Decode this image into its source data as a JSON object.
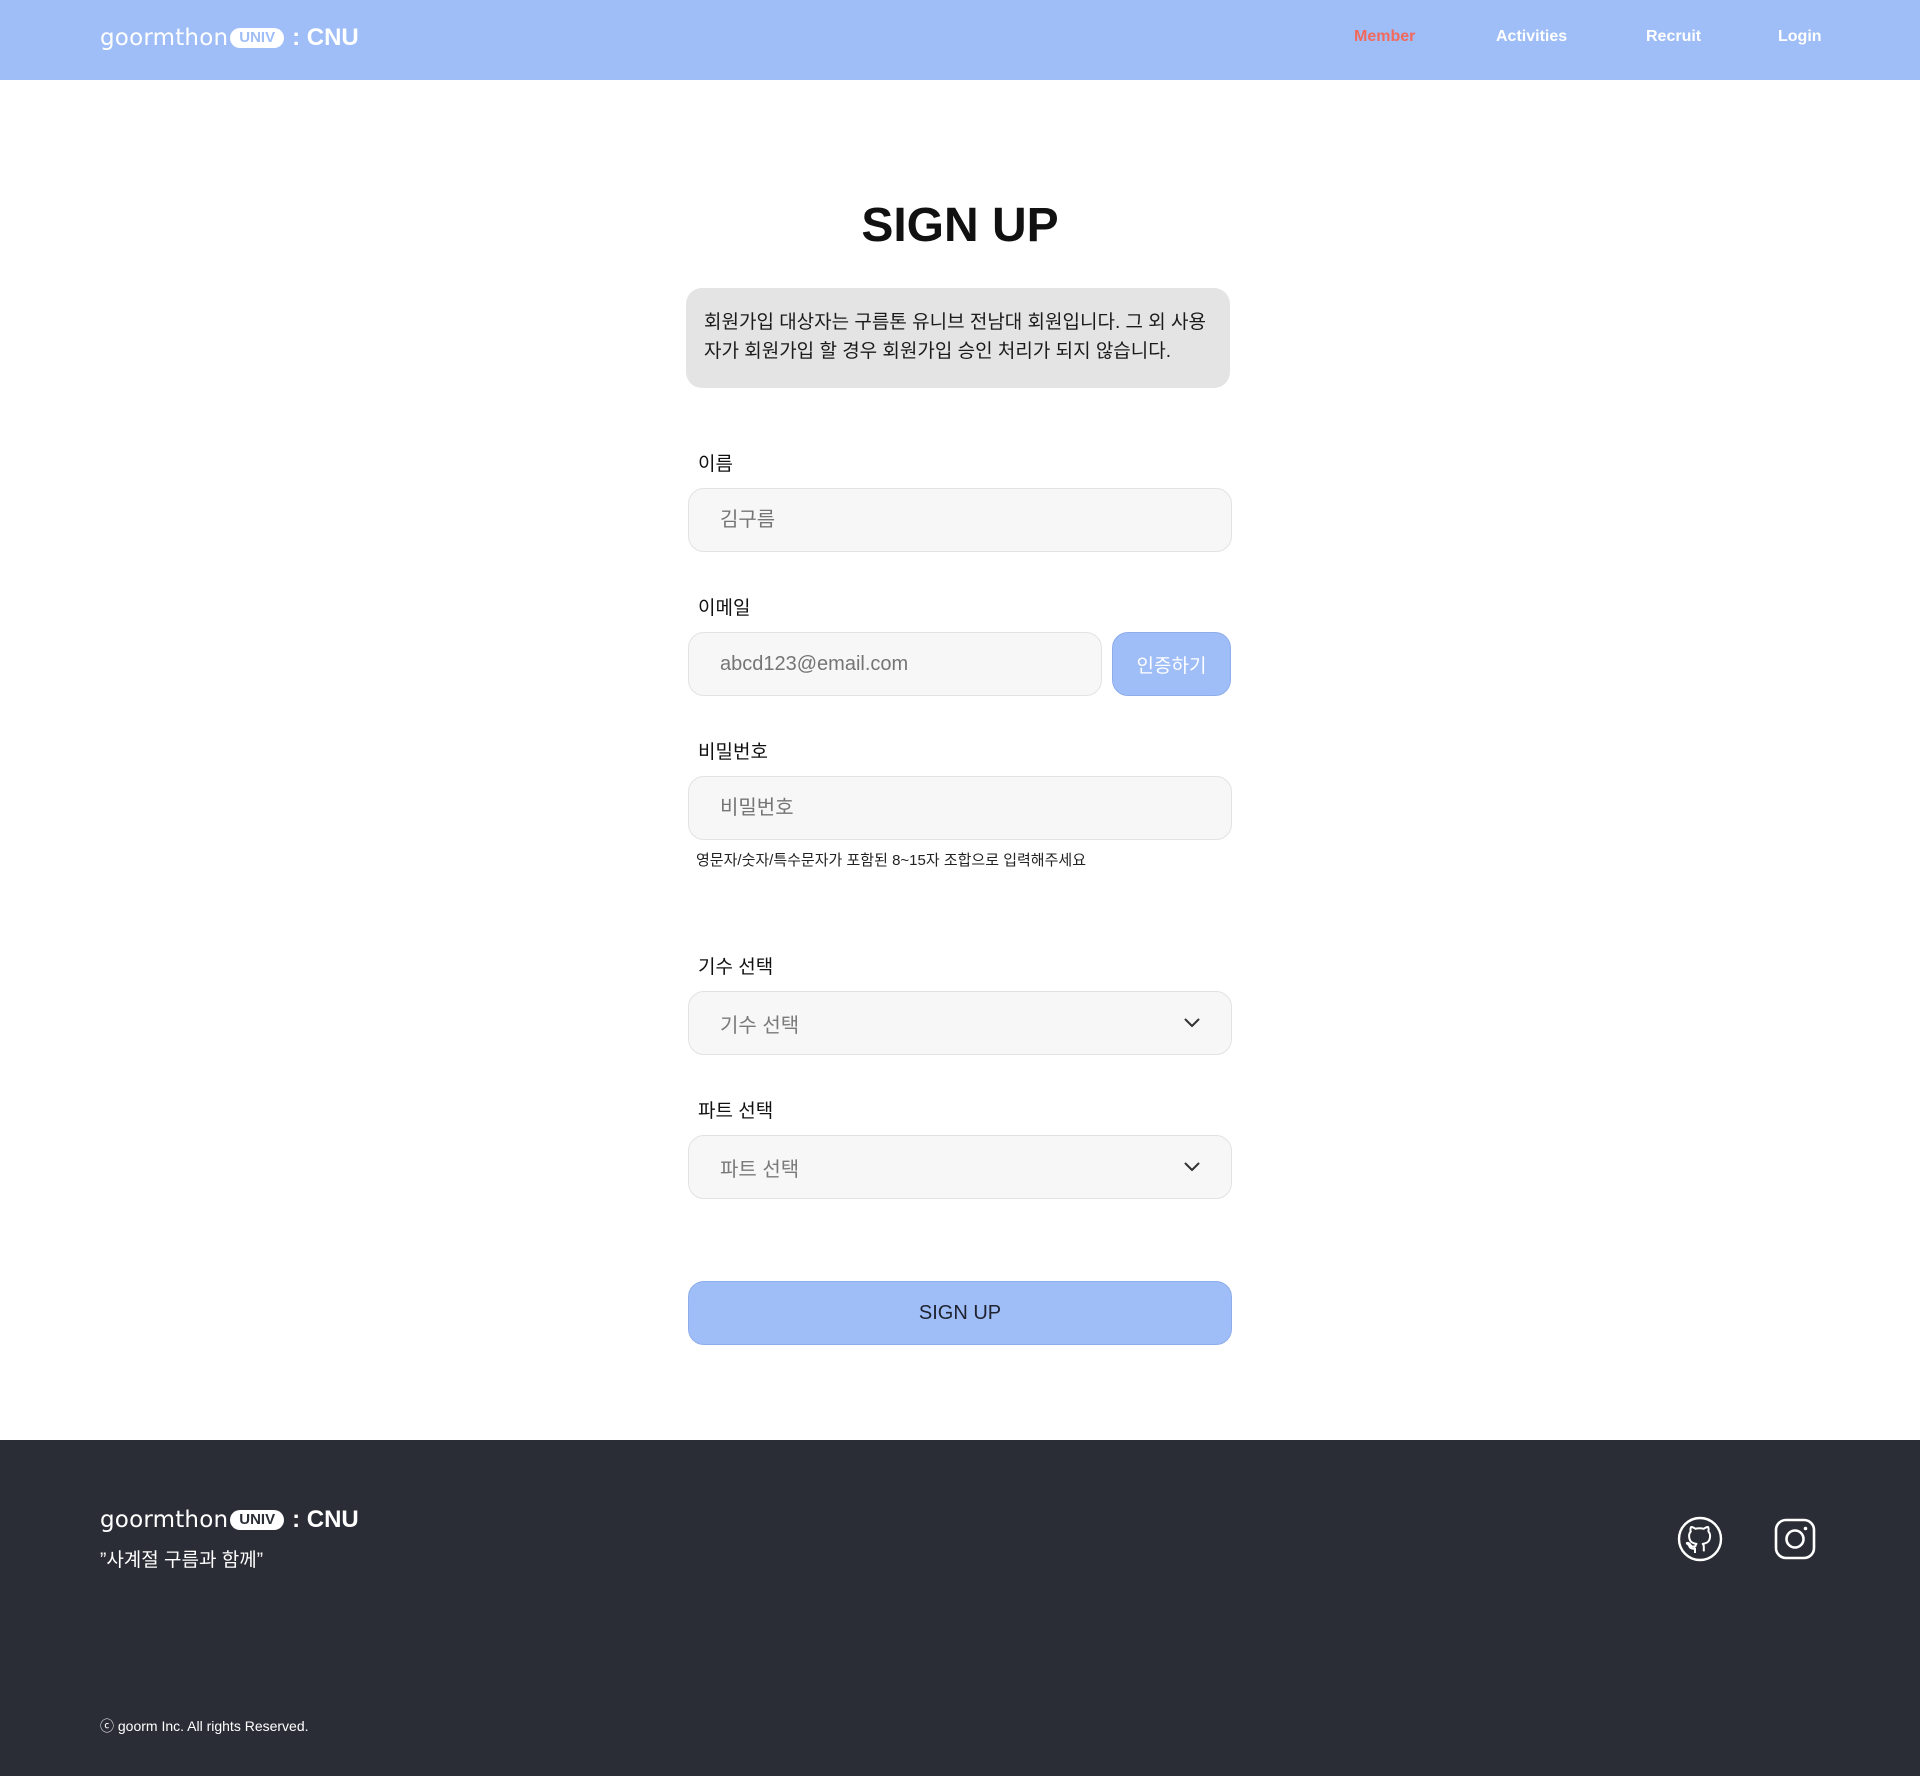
{
  "header": {
    "logo": {
      "word": "goormthon",
      "badge": "UNIV",
      "suffix": ": CNU"
    },
    "nav": [
      {
        "label": "Member",
        "active": true
      },
      {
        "label": "Activities",
        "active": false
      },
      {
        "label": "Recruit",
        "active": false
      },
      {
        "label": "Login",
        "active": false
      }
    ]
  },
  "main": {
    "title": "SIGN UP",
    "notice": "회원가입 대상자는 구름톤 유니브 전남대 회원입니다. 그 외 사용자가 회원가입 할 경우 회원가입 승인 처리가 되지 않습니다.",
    "name": {
      "label": "이름",
      "placeholder": "김구름"
    },
    "email": {
      "label": "이메일",
      "placeholder": "abcd123@email.com",
      "verify_label": "인증하기"
    },
    "password": {
      "label": "비밀번호",
      "placeholder": "비밀번호",
      "hint": "영문자/숫자/특수문자가 포함된 8~15자 조합으로 입력해주세요"
    },
    "generation": {
      "label": "기수 선택",
      "selected": "기수 선택"
    },
    "part": {
      "label": "파트 선택",
      "selected": "파트 선택"
    },
    "submit_label": "SIGN UP"
  },
  "footer": {
    "logo": {
      "word": "goormthon",
      "badge": "UNIV",
      "suffix": ": CNU"
    },
    "slogan": "”사계절 구름과 함께”",
    "copyright": "ⓒ goorm Inc. All rights Reserved.",
    "icons": [
      "github-icon",
      "instagram-icon"
    ]
  },
  "colors": {
    "accent": "#9fbdf6",
    "active_nav": "#f2695e",
    "footer_bg": "#2a2d36",
    "notice_bg": "#e4e4e4",
    "field_bg": "#f7f7f7"
  }
}
